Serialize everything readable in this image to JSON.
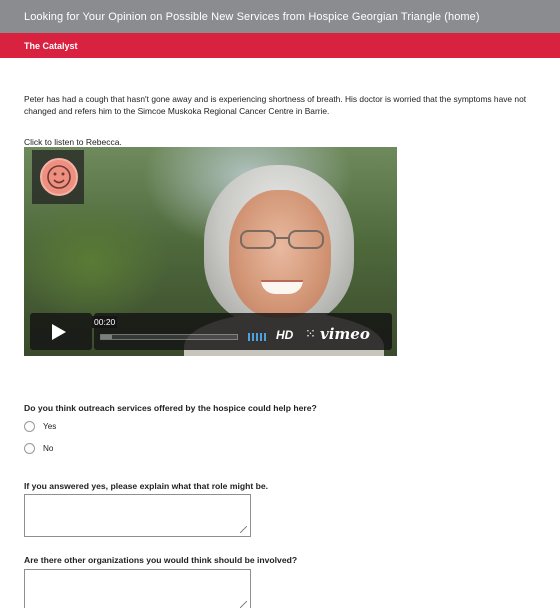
{
  "header": {
    "title": "Looking for Your Opinion on Possible New Services from Hospice Georgian Triangle (home)",
    "section": "The Catalyst"
  },
  "intro": {
    "text": "Peter has had a cough that hasn't gone away and is experiencing shortness of breath. His doctor is worried that the symptoms have not changed and refers him to the Simcoe Muskoka Regional Cancer Centre in Barrie."
  },
  "video": {
    "link_label": "Click to listen to Rebecca.",
    "time": "00:20",
    "progress": 0.08,
    "hd_label": "HD",
    "share_glyph": "⁙",
    "brand": "vimeo",
    "icons": {
      "avatar": "avatar-icon",
      "play": "play-icon",
      "volume": "volume-bars-icon",
      "share": "share-icon"
    }
  },
  "questions": [
    {
      "label": "Do you think outreach services offered by the hospice could help here?",
      "options": [
        "Yes",
        "No"
      ]
    },
    {
      "label": "If you answered yes, please explain what that role might be.",
      "value": ""
    },
    {
      "label": "Are there other organizations you would think should be involved?",
      "value": ""
    }
  ],
  "colors": {
    "top_bar": "#8a8c8f",
    "section_bar": "#d9223f",
    "vimeo_accent": "#4aa3df"
  }
}
